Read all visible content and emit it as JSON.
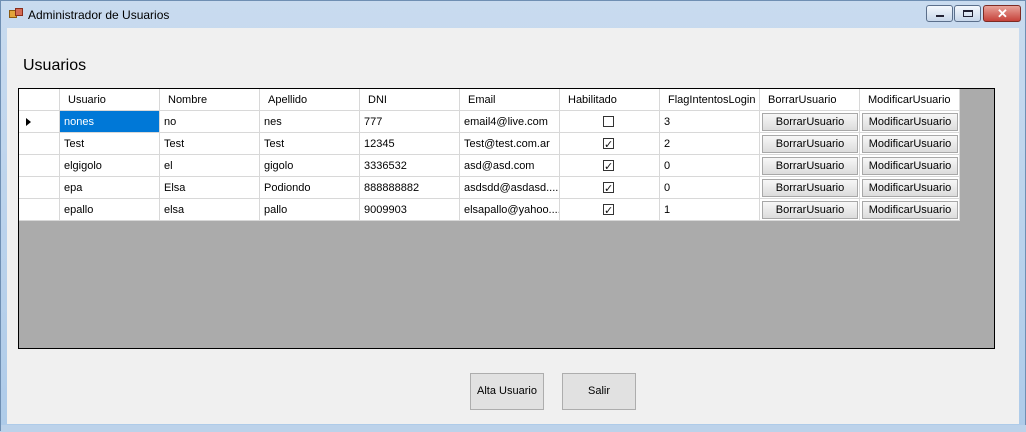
{
  "window": {
    "title": "Administrador de Usuarios",
    "icon": "app-icon"
  },
  "heading": "Usuarios",
  "grid": {
    "columns": [
      "Usuario",
      "Nombre",
      "Apellido",
      "DNI",
      "Email",
      "Habilitado",
      "FlagIntentosLogin",
      "BorrarUsuario",
      "ModificarUsuario"
    ],
    "rows": [
      {
        "usuario": "nones",
        "nombre": "no",
        "apellido": "nes",
        "dni": "777",
        "email": "email4@live.com",
        "habilitado": false,
        "flag": "3",
        "borrar": "BorrarUsuario",
        "modificar": "ModificarUsuario"
      },
      {
        "usuario": "Test",
        "nombre": "Test",
        "apellido": "Test",
        "dni": "12345",
        "email": "Test@test.com.ar",
        "habilitado": true,
        "flag": "2",
        "borrar": "BorrarUsuario",
        "modificar": "ModificarUsuario"
      },
      {
        "usuario": "elgigolo",
        "nombre": "el",
        "apellido": "gigolo",
        "dni": "3336532",
        "email": "asd@asd.com",
        "habilitado": true,
        "flag": "0",
        "borrar": "BorrarUsuario",
        "modificar": "ModificarUsuario"
      },
      {
        "usuario": "epa",
        "nombre": "Elsa",
        "apellido": "Podiondo",
        "dni": "888888882",
        "email": "asdsdd@asdasd....",
        "habilitado": true,
        "flag": "0",
        "borrar": "BorrarUsuario",
        "modificar": "ModificarUsuario"
      },
      {
        "usuario": "epallo",
        "nombre": "elsa",
        "apellido": "pallo",
        "dni": "9009903",
        "email": "elsapallo@yahoo....",
        "habilitado": true,
        "flag": "1",
        "borrar": "BorrarUsuario",
        "modificar": "ModificarUsuario"
      }
    ]
  },
  "buttons": {
    "alta": "Alta Usuario",
    "salir": "Salir"
  },
  "colors": {
    "selection": "#0078d7",
    "grid_background": "#ababab",
    "client_background": "#f0f0f0"
  }
}
